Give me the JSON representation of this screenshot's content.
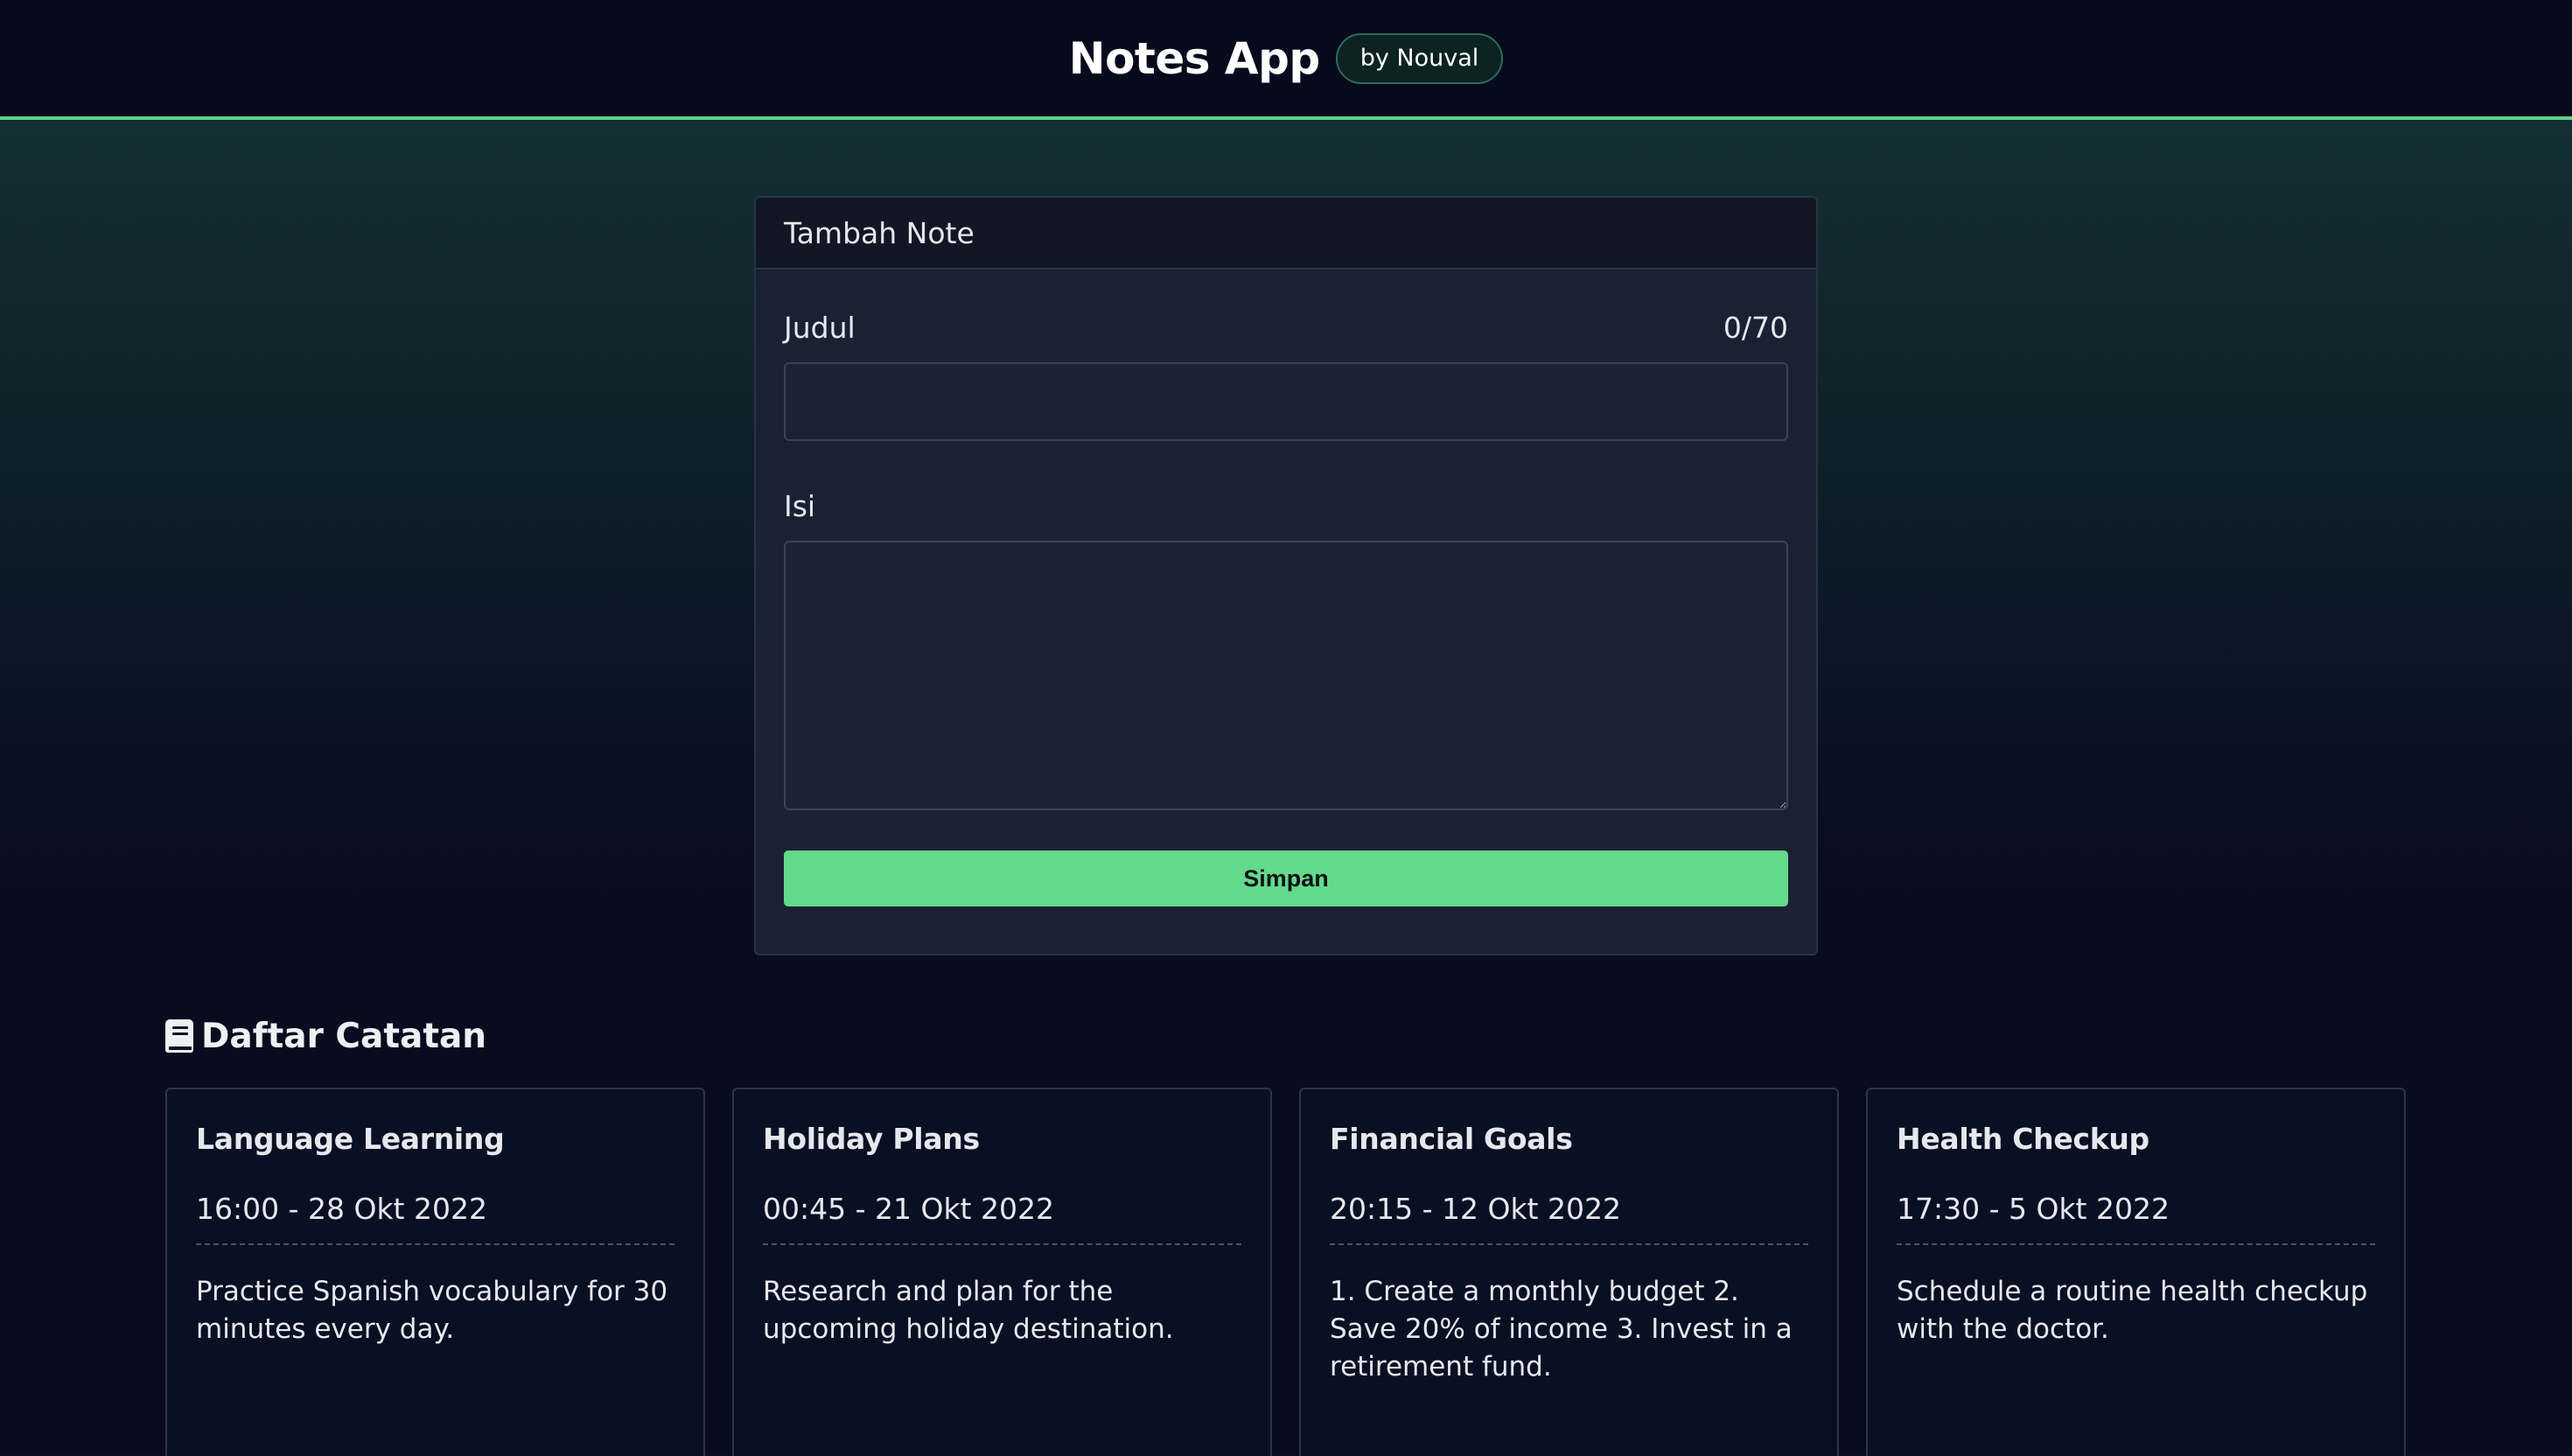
{
  "header": {
    "title": "Notes App",
    "badge": "by Nouval"
  },
  "form": {
    "heading": "Tambah Note",
    "title_label": "Judul",
    "title_counter": "0/70",
    "title_value": "",
    "body_label": "Isi",
    "body_value": "",
    "save_label": "Simpan"
  },
  "list": {
    "heading": "Daftar Catatan",
    "icon": "book-icon",
    "notes": [
      {
        "title": "Language Learning",
        "date": "16:00 - 28 Okt 2022",
        "body": "Practice Spanish vocabulary for 30 minutes every day."
      },
      {
        "title": "Holiday Plans",
        "date": "00:45 - 21 Okt 2022",
        "body": "Research and plan for the upcoming holiday destination."
      },
      {
        "title": "Financial Goals",
        "date": "20:15 - 12 Okt 2022",
        "body": "1. Create a monthly budget 2. Save 20% of income 3. Invest in a retirement fund."
      },
      {
        "title": "Health Checkup",
        "date": "17:30 - 5 Okt 2022",
        "body": "Schedule a routine health checkup with the doctor."
      }
    ]
  },
  "colors": {
    "accent": "#63d98c",
    "header_bg": "#060a1d",
    "card_bg": "#1a2133",
    "note_bg": "#0a1023"
  }
}
